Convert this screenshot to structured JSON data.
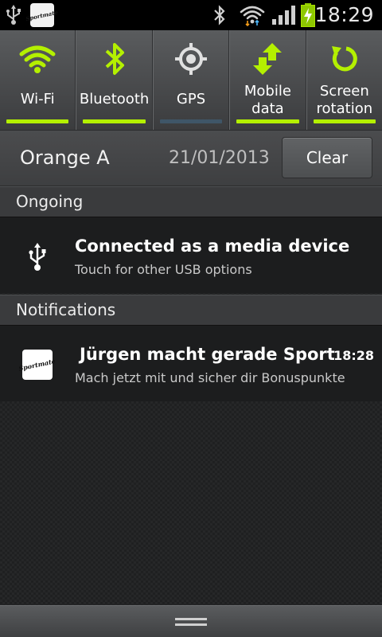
{
  "status_bar": {
    "clock": "18:29",
    "icons": [
      "usb-icon",
      "sportmate-app-icon",
      "bluetooth-icon",
      "wifi-icon",
      "signal-icon",
      "battery-charging-icon"
    ],
    "app_icon_text": "Sportmate"
  },
  "quick_settings": [
    {
      "label": "Wi-Fi",
      "icon": "wifi-icon",
      "enabled": true
    },
    {
      "label": "Bluetooth",
      "icon": "bluetooth-icon",
      "enabled": true
    },
    {
      "label": "GPS",
      "icon": "gps-icon",
      "enabled": false
    },
    {
      "label": "Mobile data",
      "line1": "Mobile",
      "line2": "data",
      "icon": "mobile-data-icon",
      "enabled": true
    },
    {
      "label": "Screen rotation",
      "line1": "Screen",
      "line2": "rotation",
      "icon": "screen-rotation-icon",
      "enabled": true
    }
  ],
  "carrier": {
    "name": "Orange A",
    "date": "21/01/2013",
    "clear_label": "Clear"
  },
  "sections": {
    "ongoing": "Ongoing",
    "notifications": "Notifications"
  },
  "ongoing": [
    {
      "icon": "usb-icon",
      "title": "Connected as a media device",
      "subtitle": "Touch for other USB options"
    }
  ],
  "notifications": [
    {
      "icon": "sportmate-app-icon",
      "icon_text": "Sportmate",
      "title": "Jürgen macht gerade Sport",
      "subtitle": "Mach jetzt mit und sicher dir Bonuspunkte",
      "time": "18:28"
    }
  ],
  "colors": {
    "accent": "#b4f000",
    "off_indicator": "#3f5668",
    "status_bar": "#000000"
  }
}
